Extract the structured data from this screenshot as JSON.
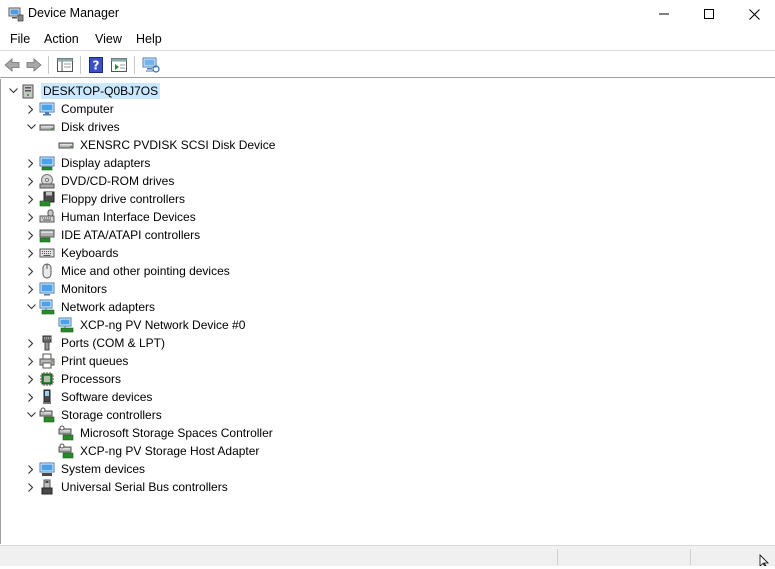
{
  "window": {
    "title": "Device Manager"
  },
  "menu": [
    "File",
    "Action",
    "View",
    "Help"
  ],
  "toolbar": [
    "back",
    "forward",
    "show-hide-console-tree",
    "help",
    "properties",
    "scan-hardware"
  ],
  "tree": {
    "root": "DESKTOP-Q0BJ7OS",
    "categories": [
      {
        "label": "Computer",
        "icon": "computer-icon",
        "expanded": false,
        "children": []
      },
      {
        "label": "Disk drives",
        "icon": "disk-drive-icon",
        "expanded": true,
        "children": [
          "XENSRC PVDISK SCSI Disk Device"
        ]
      },
      {
        "label": "Display adapters",
        "icon": "display-adapter-icon",
        "expanded": false,
        "children": []
      },
      {
        "label": "DVD/CD-ROM drives",
        "icon": "dvd-drive-icon",
        "expanded": false,
        "children": []
      },
      {
        "label": "Floppy drive controllers",
        "icon": "floppy-controller-icon",
        "expanded": false,
        "children": []
      },
      {
        "label": "Human Interface Devices",
        "icon": "hid-icon",
        "expanded": false,
        "children": []
      },
      {
        "label": "IDE ATA/ATAPI controllers",
        "icon": "ide-controller-icon",
        "expanded": false,
        "children": []
      },
      {
        "label": "Keyboards",
        "icon": "keyboard-icon",
        "expanded": false,
        "children": []
      },
      {
        "label": "Mice and other pointing devices",
        "icon": "mouse-icon",
        "expanded": false,
        "children": []
      },
      {
        "label": "Monitors",
        "icon": "monitor-icon",
        "expanded": false,
        "children": []
      },
      {
        "label": "Network adapters",
        "icon": "network-adapter-icon",
        "expanded": true,
        "children": [
          "XCP-ng PV Network Device #0"
        ]
      },
      {
        "label": "Ports (COM & LPT)",
        "icon": "port-icon",
        "expanded": false,
        "children": []
      },
      {
        "label": "Print queues",
        "icon": "printer-icon",
        "expanded": false,
        "children": []
      },
      {
        "label": "Processors",
        "icon": "processor-icon",
        "expanded": false,
        "children": []
      },
      {
        "label": "Software devices",
        "icon": "software-device-icon",
        "expanded": false,
        "children": []
      },
      {
        "label": "Storage controllers",
        "icon": "storage-controller-icon",
        "expanded": true,
        "children": [
          "Microsoft Storage Spaces Controller",
          "XCP-ng PV Storage Host Adapter"
        ]
      },
      {
        "label": "System devices",
        "icon": "system-device-icon",
        "expanded": false,
        "children": []
      },
      {
        "label": "Universal Serial Bus controllers",
        "icon": "usb-controller-icon",
        "expanded": false,
        "children": []
      }
    ]
  }
}
